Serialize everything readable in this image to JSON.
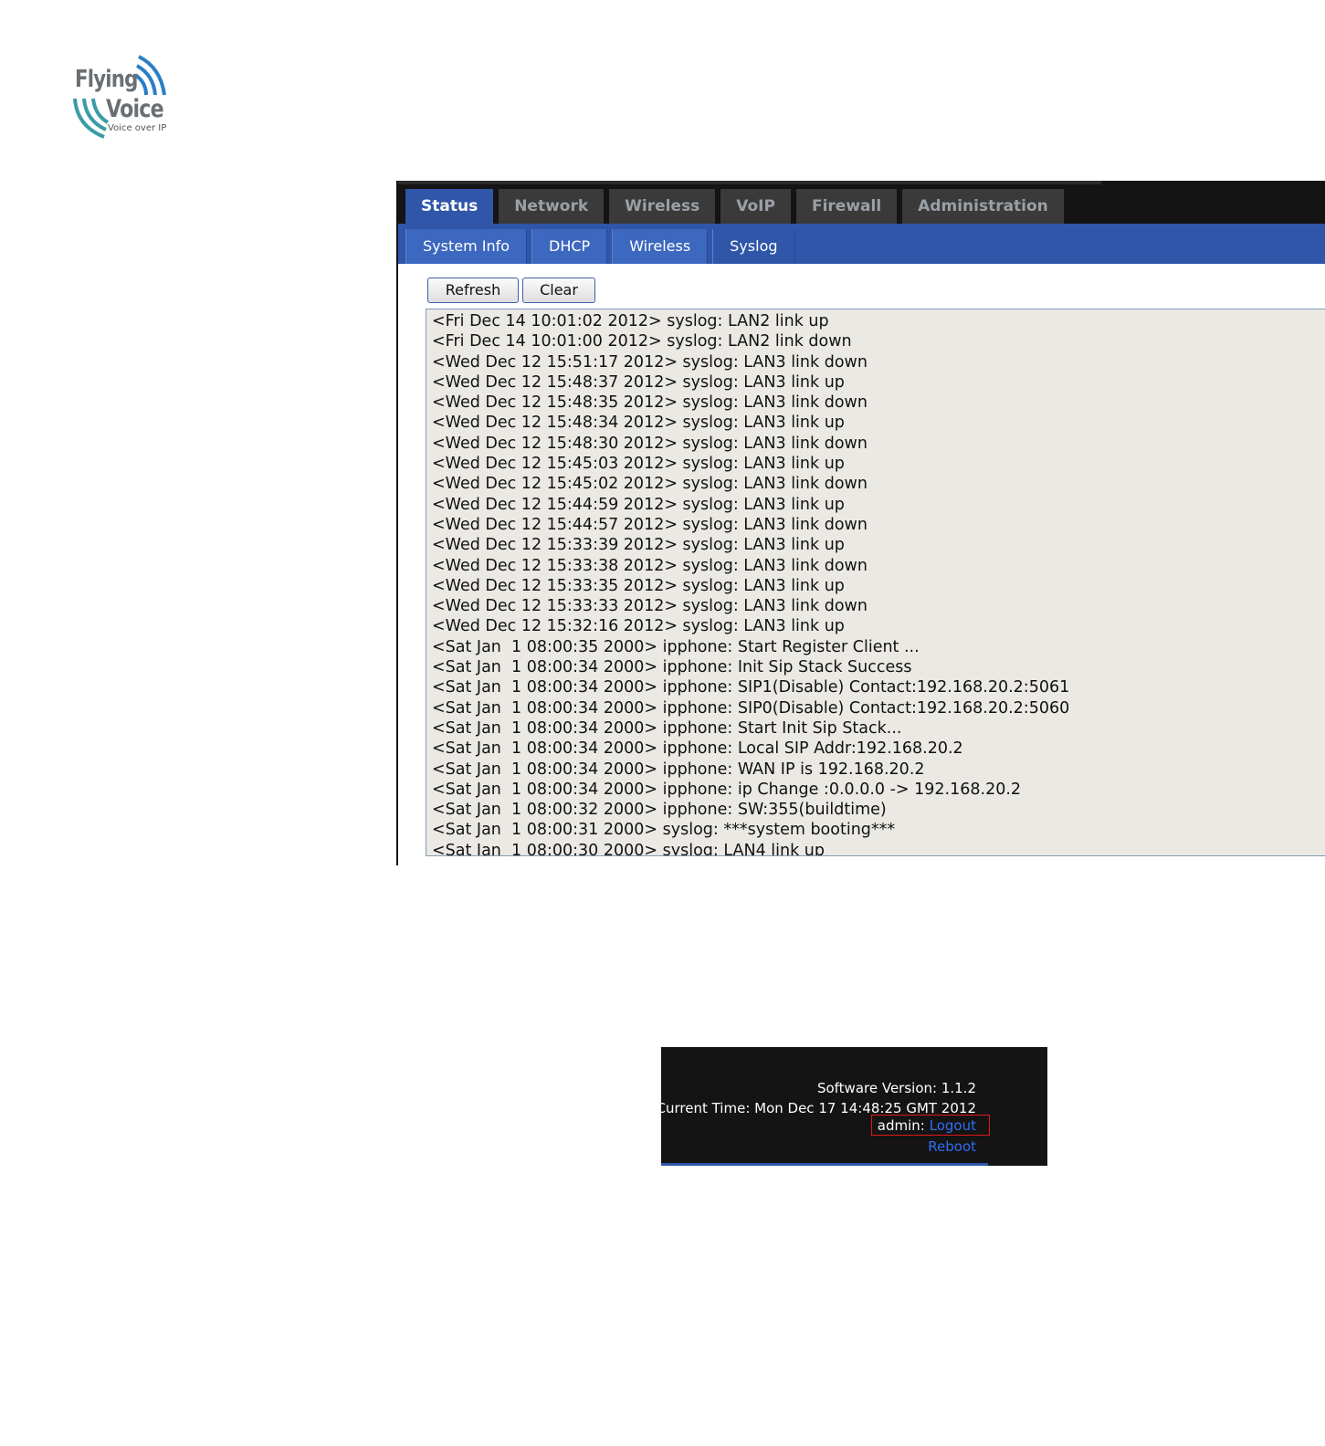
{
  "logo": {
    "brand_line1": "Flying",
    "brand_line2": "Voice",
    "tagline": "Voice over IP",
    "color": "#6a6f74"
  },
  "main_tabs": [
    {
      "label": "Status",
      "active": true
    },
    {
      "label": "Network",
      "active": false
    },
    {
      "label": "Wireless",
      "active": false
    },
    {
      "label": "VoIP",
      "active": false
    },
    {
      "label": "Firewall",
      "active": false
    },
    {
      "label": "Administration",
      "active": false
    }
  ],
  "sub_tabs": [
    {
      "label": "System Info",
      "active": false
    },
    {
      "label": "DHCP",
      "active": false
    },
    {
      "label": "Wireless",
      "active": false
    },
    {
      "label": "Syslog",
      "active": true
    }
  ],
  "buttons": {
    "refresh": "Refresh",
    "clear": "Clear"
  },
  "log_lines": [
    "<Fri Dec 14 10:01:02 2012> syslog: LAN2 link up",
    "<Fri Dec 14 10:01:00 2012> syslog: LAN2 link down",
    "<Wed Dec 12 15:51:17 2012> syslog: LAN3 link down",
    "<Wed Dec 12 15:48:37 2012> syslog: LAN3 link up",
    "<Wed Dec 12 15:48:35 2012> syslog: LAN3 link down",
    "<Wed Dec 12 15:48:34 2012> syslog: LAN3 link up",
    "<Wed Dec 12 15:48:30 2012> syslog: LAN3 link down",
    "<Wed Dec 12 15:45:03 2012> syslog: LAN3 link up",
    "<Wed Dec 12 15:45:02 2012> syslog: LAN3 link down",
    "<Wed Dec 12 15:44:59 2012> syslog: LAN3 link up",
    "<Wed Dec 12 15:44:57 2012> syslog: LAN3 link down",
    "<Wed Dec 12 15:33:39 2012> syslog: LAN3 link up",
    "<Wed Dec 12 15:33:38 2012> syslog: LAN3 link down",
    "<Wed Dec 12 15:33:35 2012> syslog: LAN3 link up",
    "<Wed Dec 12 15:33:33 2012> syslog: LAN3 link down",
    "<Wed Dec 12 15:32:16 2012> syslog: LAN3 link up",
    "<Sat Jan  1 08:00:35 2000> ipphone: Start Register Client ...",
    "<Sat Jan  1 08:00:34 2000> ipphone: Init Sip Stack Success",
    "<Sat Jan  1 08:00:34 2000> ipphone: SIP1(Disable) Contact:192.168.20.2:5061",
    "<Sat Jan  1 08:00:34 2000> ipphone: SIP0(Disable) Contact:192.168.20.2:5060",
    "<Sat Jan  1 08:00:34 2000> ipphone: Start Init Sip Stack...",
    "<Sat Jan  1 08:00:34 2000> ipphone: Local SIP Addr:192.168.20.2",
    "<Sat Jan  1 08:00:34 2000> ipphone: WAN IP is 192.168.20.2",
    "<Sat Jan  1 08:00:34 2000> ipphone: ip Change :0.0.0.0 -> 192.168.20.2",
    "<Sat Jan  1 08:00:32 2000> ipphone: SW:355(buildtime)",
    "<Sat Jan  1 08:00:31 2000> syslog: ***system booting***",
    "<Sat Jan  1 08:00:30 2000> syslog: LAN4 link up"
  ],
  "footer": {
    "software_version": "Software Version: 1.1.2",
    "current_time": "Current Time: Mon Dec 17 14:48:25 GMT 2012",
    "user_label": "admin:",
    "logout_link": "Logout",
    "reboot_link": "Reboot"
  },
  "colors": {
    "accent_blue": "#2f56a8",
    "tab_dark": "#3a3a3a",
    "log_background": "#ebe9e3",
    "link_blue": "#2f6ff5",
    "highlight_red": "#e0171b"
  },
  "icons": {
    "logo_waves": "wifi-waves-icon"
  }
}
